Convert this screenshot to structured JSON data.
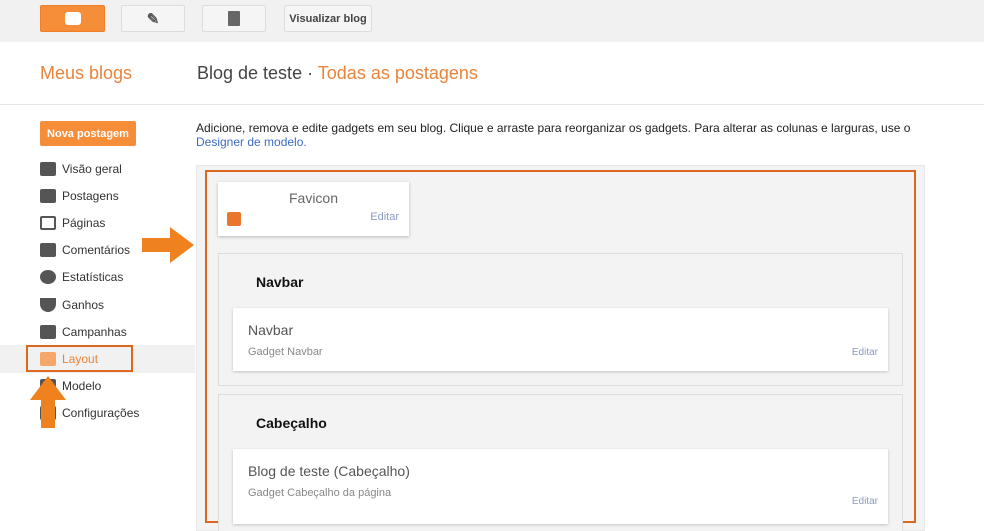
{
  "toolbar": {
    "view_blog": "Visualizar blog"
  },
  "header": {
    "my_blogs": "Meus blogs",
    "blog_name": "Blog de teste",
    "separator": "·",
    "all_posts": "Todas as postagens"
  },
  "sidebar": {
    "new_post": "Nova postagem",
    "items": [
      {
        "label": "Visão geral"
      },
      {
        "label": "Postagens"
      },
      {
        "label": "Páginas"
      },
      {
        "label": "Comentários"
      },
      {
        "label": "Estatísticas"
      },
      {
        "label": "Ganhos"
      },
      {
        "label": "Campanhas"
      },
      {
        "label": "Layout"
      },
      {
        "label": "Modelo"
      },
      {
        "label": "Configurações"
      }
    ]
  },
  "main": {
    "description": "Adicione, remova e edite gadgets em seu blog. Clique e arraste para reorganizar os gadgets. Para alterar as colunas e larguras, use o ",
    "designer_link": "Designer de modelo.",
    "favicon": {
      "title": "Favicon",
      "edit": "Editar"
    },
    "sections": [
      {
        "title": "Navbar",
        "gadget": "Navbar",
        "subtitle": "Gadget Navbar",
        "edit": "Editar"
      },
      {
        "title": "Cabeçalho",
        "gadget": "Blog de teste (Cabeçalho)",
        "subtitle": "Gadget Cabeçalho da página",
        "edit": "Editar"
      }
    ]
  },
  "colors": {
    "accent": "#f68d38",
    "highlight": "#d9691f"
  }
}
